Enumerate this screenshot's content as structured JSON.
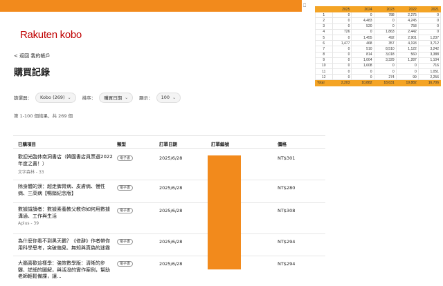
{
  "brand": {
    "logo_text": "Rakuten kobo"
  },
  "nav": {
    "back_label": "< 返回 我的帳戶"
  },
  "page": {
    "title": "購買記錄"
  },
  "filters": {
    "filter_label": "篩選器：",
    "filter_value": "Kobo (269)",
    "sort_label": "排序：",
    "sort_value": "購買日期",
    "show_label": "顯示：",
    "show_value": "100"
  },
  "results": {
    "count_text": "第 1-100 個結果，共 269 個"
  },
  "table": {
    "headers": {
      "item": "已購項目",
      "type": "類型",
      "date": "訂單日期",
      "order_no": "訂單編號",
      "price": "價格"
    },
    "rows": [
      {
        "title_lines": [
          "歡迎光臨休南洞書店（韓國書店員票選2022",
          "年度之書！）"
        ],
        "subtitle": "文字森林 - 33",
        "type": "電子書",
        "date": "2025/6/28",
        "price": "NT$301"
      },
      {
        "title_lines": [
          "除身體的淚：超走脾胃病、皮膚病、慢性",
          "病、三高病【暢銷紀念版】"
        ],
        "subtitle": "",
        "type": "電子書",
        "date": "2025/6/28",
        "price": "NT$280"
      },
      {
        "title_lines": [
          "數據識讀者：數據素養教父教你如何用數據",
          "溝通、工作與生活"
        ],
        "subtitle": "Aplus - 39",
        "type": "電子書",
        "date": "2025/6/28",
        "price": "NT$308"
      },
      {
        "title_lines": [
          "為什麼你看不到黑天鵝？《修辭》作者帶你",
          "用科學思考，突破偏見、無知與真偽的迷霧"
        ],
        "subtitle": "",
        "type": "電子書",
        "date": "2025/6/28",
        "price": "NT$294"
      },
      {
        "title_lines": [
          "大腦喜歡這樣學：強效數學版：清晰的步",
          "驟、詳細的圖解，與活潑的實作案例，幫助",
          "老師輕鬆備課，讓..."
        ],
        "subtitle": "",
        "type": "電子書",
        "date": "2025/6/28",
        "price": "NT$294"
      }
    ]
  },
  "pivot": {
    "columns": [
      "2025",
      "2024",
      "2023",
      "2022",
      "2021"
    ],
    "rows": [
      {
        "label": "1",
        "values": [
          "0",
          "0",
          "788",
          "2,275",
          "0"
        ]
      },
      {
        "label": "2",
        "values": [
          "0",
          "4,483",
          "0",
          "4,245",
          "0"
        ]
      },
      {
        "label": "3",
        "values": [
          "0",
          "520",
          "0",
          "758",
          "0"
        ]
      },
      {
        "label": "4",
        "values": [
          "726",
          "0",
          "1,863",
          "2,442",
          "0"
        ]
      },
      {
        "label": "5",
        "values": [
          "0",
          "1,455",
          "492",
          "2,901",
          "1,237"
        ]
      },
      {
        "label": "6",
        "values": [
          "1,477",
          "468",
          "357",
          "4,193",
          "3,712"
        ]
      },
      {
        "label": "7",
        "values": [
          "0",
          "510",
          "8,510",
          "1,122",
          "3,242"
        ]
      },
      {
        "label": "8",
        "values": [
          "0",
          "814",
          "3,018",
          "560",
          "3,388"
        ]
      },
      {
        "label": "9",
        "values": [
          "0",
          "1,004",
          "3,329",
          "1,287",
          "1,104"
        ]
      },
      {
        "label": "10",
        "values": [
          "0",
          "1,608",
          "0",
          "0",
          "716"
        ]
      },
      {
        "label": "11",
        "values": [
          "0",
          "0",
          "0",
          "0",
          "1,051"
        ]
      },
      {
        "label": "12",
        "values": [
          "0",
          "0",
          "274",
          "99",
          "2,256"
        ]
      }
    ],
    "total": {
      "label": "Total",
      "values": [
        "2,203",
        "10,882",
        "18,631",
        "19,882",
        "16,706"
      ]
    }
  },
  "colors": {
    "accent_orange": "#f28a1c",
    "brand_red": "#bf0000",
    "pivot_header": "#f4a425"
  }
}
